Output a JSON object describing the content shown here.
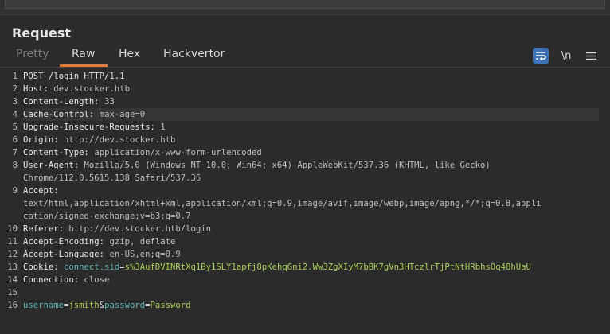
{
  "panel": {
    "title": "Request"
  },
  "tabs": [
    {
      "label": "Pretty",
      "state": "disabled"
    },
    {
      "label": "Raw",
      "state": "active"
    },
    {
      "label": "Hex",
      "state": "normal"
    },
    {
      "label": "Hackvertor",
      "state": "normal"
    }
  ],
  "toolbar": {
    "wrap_icon": "wrap-lines-icon",
    "newline_label": "\\n",
    "menu_icon": "hamburger-menu-icon"
  },
  "colors": {
    "background": "#2b2b2b",
    "accent_underline": "#e07b3a",
    "active_button": "#3d73b5",
    "highlight_line": "#353535",
    "cookie_value": "#a8cc59"
  },
  "editor": {
    "highlighted_line": 4,
    "lines": [
      {
        "num": "1",
        "key": "POST /login HTTP/1.1",
        "sep": "",
        "val": ""
      },
      {
        "num": "2",
        "key": "Host",
        "sep": ": ",
        "val": "dev.stocker.htb"
      },
      {
        "num": "3",
        "key": "Content-Length",
        "sep": ": ",
        "val": "33"
      },
      {
        "num": "4",
        "key": "Cache-Control",
        "sep": ": ",
        "val": "max-age=0"
      },
      {
        "num": "5",
        "key": "Upgrade-Insecure-Requests",
        "sep": ": ",
        "val": "1"
      },
      {
        "num": "6",
        "key": "Origin",
        "sep": ": ",
        "val": "http://dev.stocker.htb"
      },
      {
        "num": "7",
        "key": "Content-Type",
        "sep": ": ",
        "val": "application/x-www-form-urlencoded"
      },
      {
        "num": "8",
        "key": "User-Agent",
        "sep": ": ",
        "val": "Mozilla/5.0 (Windows NT 10.0; Win64; x64) AppleWebKit/537.36 (KHTML, like Gecko)"
      },
      {
        "num": "",
        "key": "",
        "sep": "",
        "val": "Chrome/112.0.5615.138 Safari/537.36"
      },
      {
        "num": "9",
        "key": "Accept",
        "sep": ":",
        "val": ""
      },
      {
        "num": "",
        "key": "",
        "sep": "",
        "val": "text/html,application/xhtml+xml,application/xml;q=0.9,image/avif,image/webp,image/apng,*/*;q=0.8,appli"
      },
      {
        "num": "",
        "key": "",
        "sep": "",
        "val": "cation/signed-exchange;v=b3;q=0.7"
      },
      {
        "num": "10",
        "key": "Referer",
        "sep": ": ",
        "val": "http://dev.stocker.htb/login"
      },
      {
        "num": "11",
        "key": "Accept-Encoding",
        "sep": ": ",
        "val": "gzip, deflate"
      },
      {
        "num": "12",
        "key": "Accept-Language",
        "sep": ": ",
        "val": "en-US,en;q=0.9"
      },
      {
        "num": "13",
        "key": "Cookie",
        "sep": ": ",
        "val": "",
        "cookie_name": "connect.sid",
        "cookie_eq": "=",
        "cookie_value": "s%3AufDVINRtXq1By1SLY1apfj8pKehqGni2.Ww3ZgXIyM7bBK7gVn3HTczlrTjPtNtHRbhsOq48hUaU"
      },
      {
        "num": "14",
        "key": "Connection",
        "sep": ": ",
        "val": "close"
      },
      {
        "num": "15",
        "key": "",
        "sep": "",
        "val": ""
      },
      {
        "num": "16",
        "key": "",
        "sep": "",
        "val": "",
        "body": true,
        "body_k1": "username",
        "body_eq1": "=",
        "body_v1": "jsmith",
        "body_amp": "&",
        "body_k2": "password",
        "body_eq2": "=",
        "body_v2": "Password"
      }
    ]
  }
}
